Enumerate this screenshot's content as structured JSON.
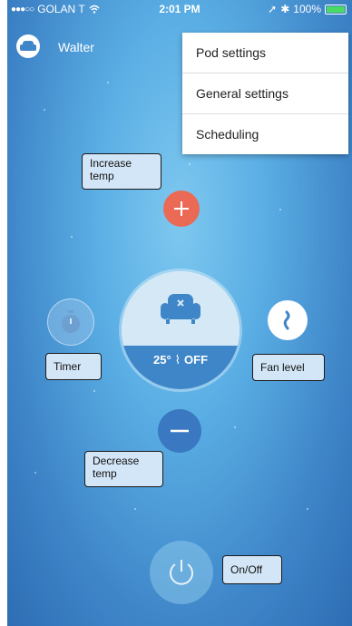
{
  "status_bar": {
    "carrier": "GOLAN T",
    "time": "2:01 PM",
    "battery": "100%"
  },
  "header": {
    "user_name": "Walter"
  },
  "menu": {
    "items": [
      {
        "label": "Pod settings"
      },
      {
        "label": "General settings"
      },
      {
        "label": "Scheduling"
      }
    ]
  },
  "callouts": {
    "increase_temp": "Increase temp",
    "decrease_temp": "Decrease temp",
    "timer": "Timer",
    "fan_level": "Fan level",
    "on_off": "On/Off"
  },
  "device": {
    "temperature": "25°",
    "mode": "OFF"
  },
  "colors": {
    "accent_red": "#ea6a55",
    "accent_blue": "#3a78c2",
    "background_blue": "#5aaee4"
  },
  "icons": {
    "plus": "plus-icon",
    "minus": "minus-icon",
    "timer": "stopwatch-icon",
    "fan": "fan-level-icon",
    "power": "power-icon",
    "armchair": "armchair-icon"
  }
}
